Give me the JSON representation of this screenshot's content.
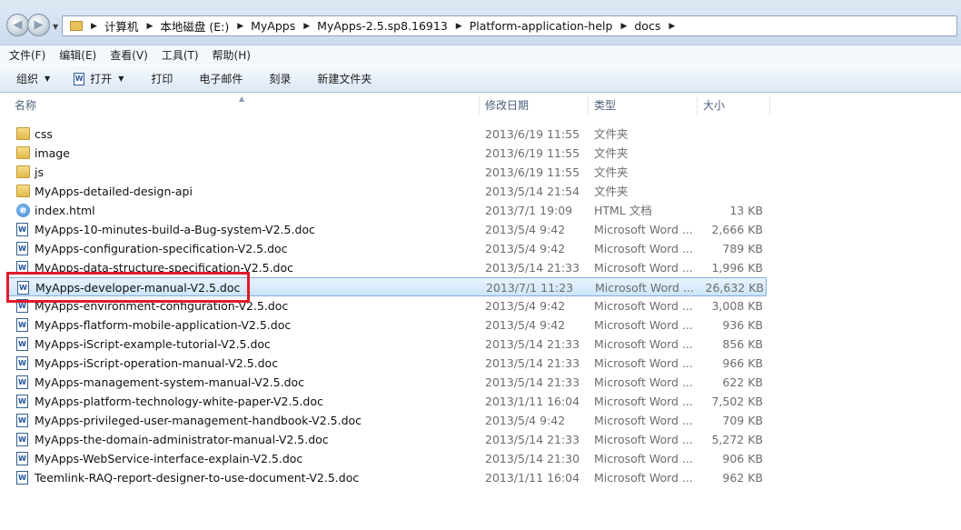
{
  "address": {
    "crumbs": [
      "计算机",
      "本地磁盘 (E:)",
      "MyApps",
      "MyApps-2.5.sp8.16913",
      "Platform-application-help",
      "docs"
    ]
  },
  "menu": [
    "文件(F)",
    "编辑(E)",
    "查看(V)",
    "工具(T)",
    "帮助(H)"
  ],
  "commands": {
    "organize": "组织",
    "open": "打开",
    "print": "打印",
    "email": "电子邮件",
    "burn": "刻录",
    "new_folder": "新建文件夹"
  },
  "columns": {
    "name": "名称",
    "date": "修改日期",
    "type": "类型",
    "size": "大小"
  },
  "files": [
    {
      "name": "css",
      "date": "2013/6/19 11:55",
      "type": "文件夹",
      "size": "",
      "icon": "folder-icon"
    },
    {
      "name": "image",
      "date": "2013/6/19 11:55",
      "type": "文件夹",
      "size": "",
      "icon": "folder-icon"
    },
    {
      "name": "js",
      "date": "2013/6/19 11:55",
      "type": "文件夹",
      "size": "",
      "icon": "folder-icon"
    },
    {
      "name": "MyApps-detailed-design-api",
      "date": "2013/5/14 21:54",
      "type": "文件夹",
      "size": "",
      "icon": "folder-icon"
    },
    {
      "name": "index.html",
      "date": "2013/7/1 19:09",
      "type": "HTML 文档",
      "size": "13 KB",
      "icon": "html-icon"
    },
    {
      "name": "MyApps-10-minutes-build-a-Bug-system-V2.5.doc",
      "date": "2013/5/4 9:42",
      "type": "Microsoft Word ...",
      "size": "2,666 KB",
      "icon": "word-doc-icon"
    },
    {
      "name": "MyApps-configuration-specification-V2.5.doc",
      "date": "2013/5/4 9:42",
      "type": "Microsoft Word ...",
      "size": "789 KB",
      "icon": "word-doc-icon"
    },
    {
      "name": "MyApps-data-structure-specification-V2.5.doc",
      "date": "2013/5/14 21:33",
      "type": "Microsoft Word ...",
      "size": "1,996 KB",
      "icon": "word-doc-icon"
    },
    {
      "name": "MyApps-developer-manual-V2.5.doc",
      "date": "2013/7/1 11:23",
      "type": "Microsoft Word ...",
      "size": "26,632 KB",
      "icon": "word-doc-icon",
      "selected": true
    },
    {
      "name": "MyApps-environment-configuration-V2.5.doc",
      "date": "2013/5/4 9:42",
      "type": "Microsoft Word ...",
      "size": "3,008 KB",
      "icon": "word-doc-icon"
    },
    {
      "name": "MyApps-flatform-mobile-application-V2.5.doc",
      "date": "2013/5/4 9:42",
      "type": "Microsoft Word ...",
      "size": "936 KB",
      "icon": "word-doc-icon"
    },
    {
      "name": "MyApps-iScript-example-tutorial-V2.5.doc",
      "date": "2013/5/14 21:33",
      "type": "Microsoft Word ...",
      "size": "856 KB",
      "icon": "word-doc-icon"
    },
    {
      "name": "MyApps-iScript-operation-manual-V2.5.doc",
      "date": "2013/5/14 21:33",
      "type": "Microsoft Word ...",
      "size": "966 KB",
      "icon": "word-doc-icon"
    },
    {
      "name": "MyApps-management-system-manual-V2.5.doc",
      "date": "2013/5/14 21:33",
      "type": "Microsoft Word ...",
      "size": "622 KB",
      "icon": "word-doc-icon"
    },
    {
      "name": "MyApps-platform-technology-white-paper-V2.5.doc",
      "date": "2013/1/11 16:04",
      "type": "Microsoft Word ...",
      "size": "7,502 KB",
      "icon": "word-doc-icon"
    },
    {
      "name": "MyApps-privileged-user-management-handbook-V2.5.doc",
      "date": "2013/5/4 9:42",
      "type": "Microsoft Word ...",
      "size": "709 KB",
      "icon": "word-doc-icon"
    },
    {
      "name": "MyApps-the-domain-administrator-manual-V2.5.doc",
      "date": "2013/5/14 21:33",
      "type": "Microsoft Word ...",
      "size": "5,272 KB",
      "icon": "word-doc-icon"
    },
    {
      "name": "MyApps-WebService-interface-explain-V2.5.doc",
      "date": "2013/5/14 21:30",
      "type": "Microsoft Word ...",
      "size": "906 KB",
      "icon": "word-doc-icon"
    },
    {
      "name": "Teemlink-RAQ-report-designer-to-use-document-V2.5.doc",
      "date": "2013/1/11 16:04",
      "type": "Microsoft Word ...",
      "size": "962 KB",
      "icon": "word-doc-icon"
    }
  ],
  "colors": {
    "highlight_border": "#e2192b",
    "selection_border": "#84acdd"
  }
}
